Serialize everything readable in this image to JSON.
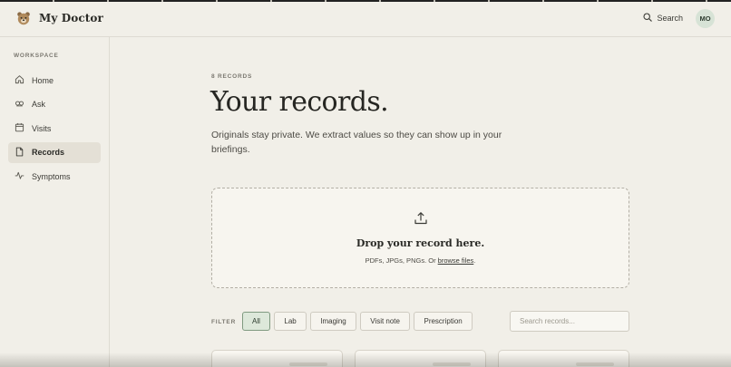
{
  "app": {
    "name": "My Doctor",
    "logo_icon": "bear-icon"
  },
  "header": {
    "search_label": "Search",
    "avatar_initials": "MO"
  },
  "sidebar": {
    "section_label": "WORKSPACE",
    "items": [
      {
        "label": "Home",
        "icon": "home-icon",
        "active": false
      },
      {
        "label": "Ask",
        "icon": "chat-icon",
        "active": false
      },
      {
        "label": "Visits",
        "icon": "calendar-icon",
        "active": false
      },
      {
        "label": "Records",
        "icon": "document-icon",
        "active": true
      },
      {
        "label": "Symptoms",
        "icon": "pulse-icon",
        "active": false
      }
    ]
  },
  "main": {
    "eyebrow": "8 RECORDS",
    "title": "Your records.",
    "subtitle": "Originals stay private. We extract values so they can show up in your briefings."
  },
  "dropzone": {
    "icon": "upload-icon",
    "title": "Drop your record here.",
    "subtitle_prefix": "PDFs, JPGs, PNGs. Or ",
    "link_label": "browse files",
    "subtitle_suffix": "."
  },
  "filter": {
    "label": "FILTER",
    "chips": [
      {
        "label": "All",
        "active": true
      },
      {
        "label": "Lab",
        "active": false
      },
      {
        "label": "Imaging",
        "active": false
      },
      {
        "label": "Visit note",
        "active": false
      },
      {
        "label": "Prescription",
        "active": false
      }
    ],
    "search_placeholder": "Search records..."
  },
  "colors": {
    "background": "#f1efe8",
    "active_nav": "#e4e0d6",
    "active_chip": "#dde8da",
    "avatar_bg": "#d7e3d6"
  }
}
